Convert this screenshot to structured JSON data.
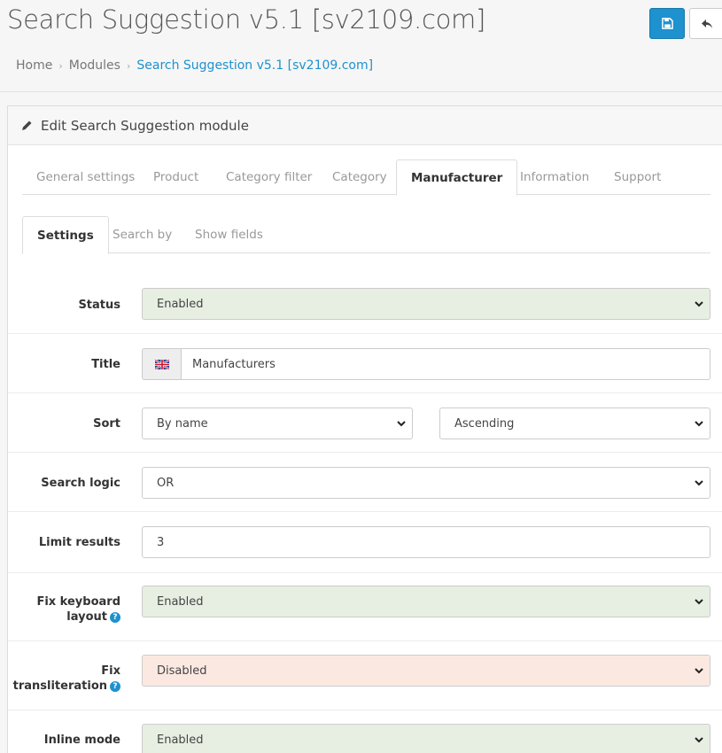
{
  "header": {
    "title": "Search Suggestion v5.1 [sv2109.com]",
    "breadcrumb": [
      "Home",
      "Modules",
      "Search Suggestion v5.1 [sv2109.com]"
    ]
  },
  "panel": {
    "heading": "Edit Search Suggestion module"
  },
  "tabs": [
    "General settings",
    "Product",
    "Category filter",
    "Category",
    "Manufacturer",
    "Information",
    "Support"
  ],
  "active_tab": "Manufacturer",
  "subtabs": [
    "Settings",
    "Search by",
    "Show fields"
  ],
  "active_subtab": "Settings",
  "form": {
    "status": {
      "label": "Status",
      "value": "Enabled"
    },
    "title": {
      "label": "Title",
      "value": "Manufacturers"
    },
    "sort": {
      "label": "Sort",
      "field": "By name",
      "order": "Ascending"
    },
    "search_logic": {
      "label": "Search logic",
      "value": "OR"
    },
    "limit_results": {
      "label": "Limit results",
      "value": "3"
    },
    "fix_keyboard_layout": {
      "label_line1": "Fix keyboard",
      "label_line2": "layout",
      "value": "Enabled"
    },
    "fix_transliteration": {
      "label_line1": "Fix",
      "label_line2": "transliteration",
      "value": "Disabled"
    },
    "inline_mode": {
      "label": "Inline mode",
      "value": "Enabled"
    }
  },
  "help_glyph": "?",
  "icons": [
    "save-icon",
    "reply-icon",
    "pencil-icon",
    "uk-flag-icon",
    "chevron-down-icon",
    "help-icon"
  ],
  "colors": {
    "primary": "#1e91cf",
    "enabled_bg": "#e7efe3",
    "disabled_bg": "#fbe9e1"
  }
}
